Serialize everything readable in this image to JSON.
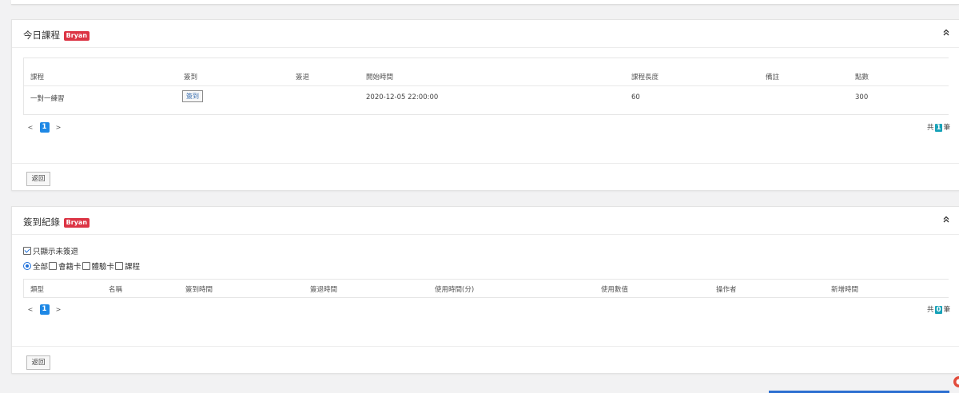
{
  "panel_today": {
    "title": "今日課程",
    "badge": "Bryan",
    "columns": [
      "課程",
      "簽到",
      "簽退",
      "開始時間",
      "課程長度",
      "備註",
      "點數"
    ],
    "rows": [
      {
        "course": "一對一練習",
        "signin_button": "簽到",
        "signout": "",
        "start_time": "2020-12-05 22:00:00",
        "length": "60",
        "note": "",
        "points": "300"
      }
    ],
    "pager": {
      "prev": "<",
      "page": "1",
      "next": ">"
    },
    "total": {
      "prefix": "共",
      "count": "1",
      "suffix": "筆"
    },
    "back_button": "返回"
  },
  "panel_records": {
    "title": "簽到紀錄",
    "badge": "Bryan",
    "only_show_unsigned": {
      "label": "只顯示未簽退",
      "checked": true
    },
    "filters": [
      {
        "type": "radio",
        "label": "全部",
        "checked": true
      },
      {
        "type": "checkbox",
        "label": "會籍卡",
        "checked": false
      },
      {
        "type": "checkbox",
        "label": "體驗卡",
        "checked": false
      },
      {
        "type": "checkbox",
        "label": "課程",
        "checked": false
      }
    ],
    "columns": [
      "類型",
      "名稱",
      "簽到時間",
      "簽退時間",
      "使用時間(分)",
      "使用數值",
      "操作者",
      "新增時間"
    ],
    "pager": {
      "prev": "<",
      "page": "1",
      "next": ">"
    },
    "total": {
      "prefix": "共",
      "count": "0",
      "suffix": "筆"
    },
    "back_button": "返回"
  },
  "colors": {
    "badge": "#dc3545",
    "page_active": "#1e88e5",
    "total_badge": "#17a2b8",
    "link": "#3a6fb0"
  }
}
